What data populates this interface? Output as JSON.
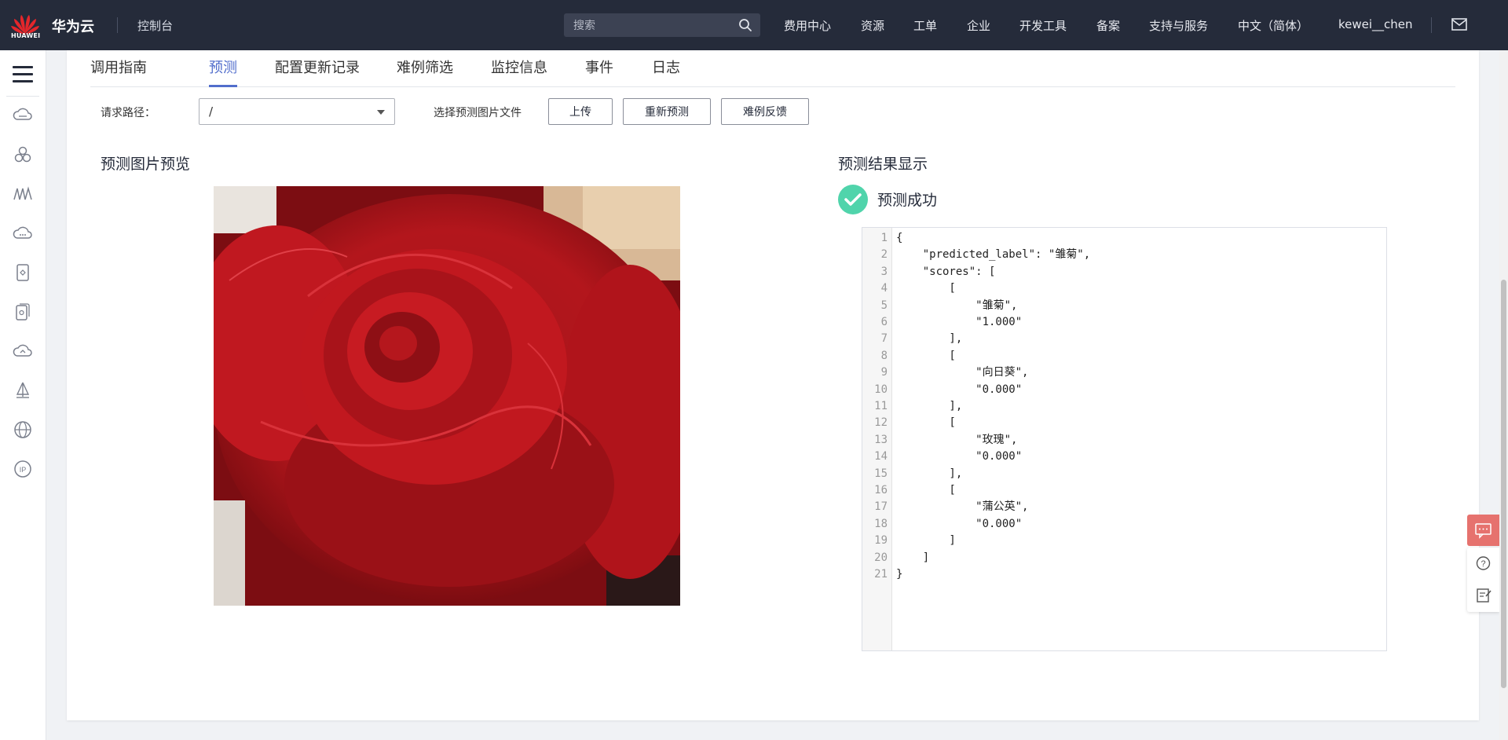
{
  "header": {
    "logo_text": "HUAWEI",
    "brand": "华为云",
    "console": "控制台",
    "search_placeholder": "搜索",
    "nav": [
      "费用中心",
      "资源",
      "工单",
      "企业",
      "开发工具",
      "备案",
      "支持与服务",
      "中文（简体）",
      "kewei__chen"
    ]
  },
  "sidebar": {
    "icons": [
      "cloud-server-icon",
      "cluster-icon",
      "waveform-icon",
      "cloud-storage-icon",
      "container-icon",
      "database-icon",
      "cloud-sync-icon",
      "deploy-icon",
      "globe-icon",
      "ip-icon"
    ]
  },
  "tabs": [
    "调用指南",
    "预测",
    "配置更新记录",
    "难例筛选",
    "监控信息",
    "事件",
    "日志"
  ],
  "active_tab": "预测",
  "form": {
    "path_label": "请求路径：",
    "path_value": "/",
    "file_label": "选择预测图片文件",
    "upload": "上传",
    "repredict": "重新预测",
    "feedback": "难例反馈"
  },
  "preview_title": "预测图片预览",
  "result": {
    "title": "预测结果显示",
    "status": "预测成功",
    "lines": [
      "{",
      "    \"predicted_label\": \"雏菊\",",
      "    \"scores\": [",
      "        [",
      "            \"雏菊\",",
      "            \"1.000\"",
      "        ],",
      "        [",
      "            \"向日葵\",",
      "            \"0.000\"",
      "        ],",
      "        [",
      "            \"玫瑰\",",
      "            \"0.000\"",
      "        ],",
      "        [",
      "            \"蒲公英\",",
      "            \"0.000\"",
      "        ]",
      "    ]",
      "}"
    ]
  },
  "colors": {
    "topbar": "#252b3a",
    "accent": "#526ecc",
    "success": "#50d4ab",
    "float_red": "#e6726e"
  }
}
